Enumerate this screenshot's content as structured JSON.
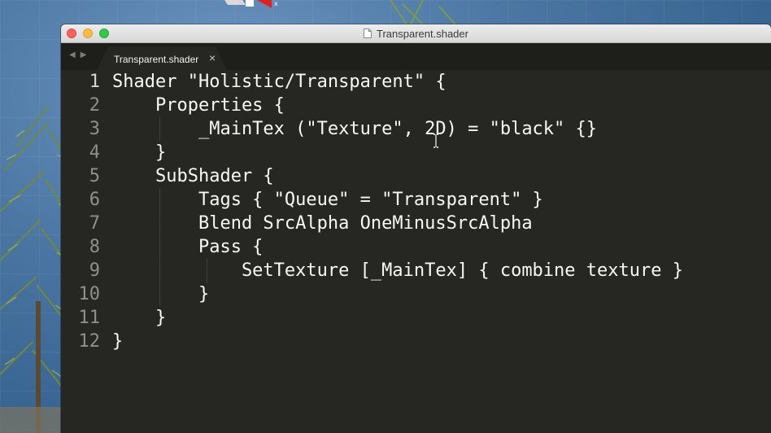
{
  "window": {
    "title": "Transparent.shader",
    "tab_label": "Transparent.shader",
    "tab_close": "×",
    "nav_back": "◀",
    "nav_forward": "▶"
  },
  "editor": {
    "lines": [
      {
        "number": "1",
        "text": "Shader \"Holistic/Transparent\" {"
      },
      {
        "number": "2",
        "text": "    Properties {"
      },
      {
        "number": "3",
        "text": "        _MainTex (\"Texture\", 2D) = \"black\" {}"
      },
      {
        "number": "4",
        "text": "    }"
      },
      {
        "number": "5",
        "text": "    SubShader {"
      },
      {
        "number": "6",
        "text": "        Tags { \"Queue\" = \"Transparent\" }"
      },
      {
        "number": "7",
        "text": "        Blend SrcAlpha OneMinusSrcAlpha"
      },
      {
        "number": "8",
        "text": "        Pass {"
      },
      {
        "number": "9",
        "text": "            SetTexture [_MainTex] { combine texture }"
      },
      {
        "number": "10",
        "text": "        }"
      },
      {
        "number": "11",
        "text": "    }"
      },
      {
        "number": "12",
        "text": "}"
      }
    ]
  },
  "colors": {
    "editor_bg": "#262723",
    "tabbar_bg": "#1e1f1b",
    "code_text": "#f8f8f2",
    "gutter_text": "#8f908a"
  }
}
